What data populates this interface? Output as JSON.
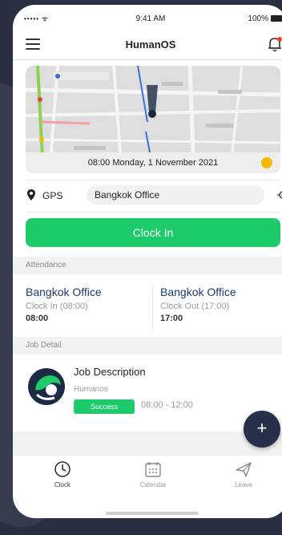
{
  "status_bar": {
    "signal": "••••• ᯤ",
    "time": "9:41 AM",
    "battery": "100%"
  },
  "header": {
    "title": "HumanOS"
  },
  "map": {
    "datetime": "08:00 Monday, 1 November 2021"
  },
  "gps": {
    "label": "GPS",
    "location": "Bangkok Office"
  },
  "clock_in_button": {
    "label": "Clock In"
  },
  "attendance": {
    "section_title": "Attendance",
    "clock_in": {
      "office": "Bangkok Office",
      "label": "Clock In (08:00)",
      "time": "08:00"
    },
    "clock_out": {
      "office": "Bangkok Office",
      "label": "Clock Out (17:00)",
      "time": "17:00"
    }
  },
  "job_detail": {
    "section_title": "Job Detail",
    "title": "Job Description",
    "company": "Humanos",
    "status": "Success",
    "time_range": "08:00 - 12:00"
  },
  "fab": {
    "label": "+"
  },
  "tabs": [
    {
      "label": "Clock",
      "icon": "clock-icon",
      "active": true
    },
    {
      "label": "Calendar",
      "icon": "calendar-icon",
      "active": false
    },
    {
      "label": "Leave",
      "icon": "plane-icon",
      "active": false
    }
  ],
  "colors": {
    "accent": "#1ecb6b",
    "navy": "#263148",
    "link": "#1c3a6e"
  }
}
